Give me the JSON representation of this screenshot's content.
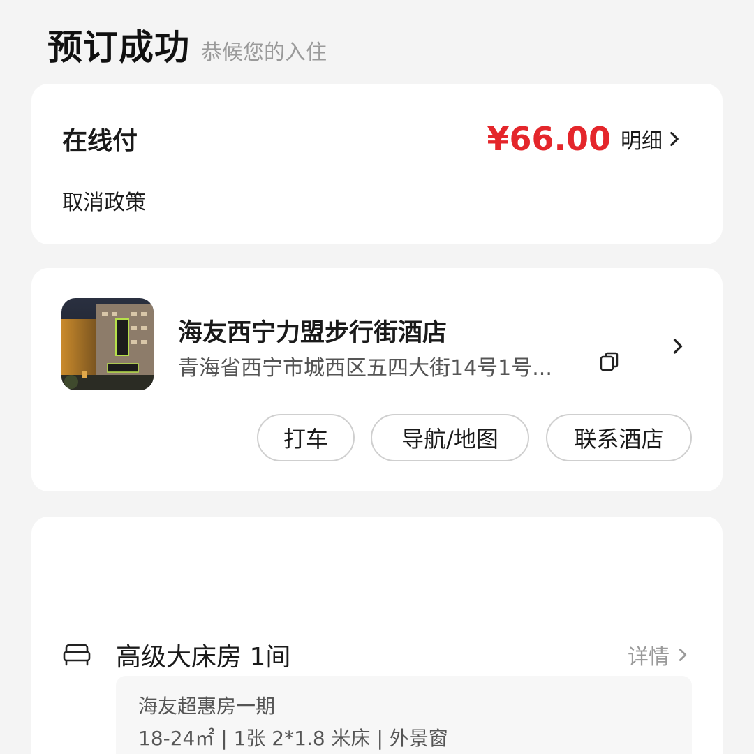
{
  "header": {
    "title": "预订成功",
    "subtitle": "恭候您的入住"
  },
  "payment": {
    "label": "在线付",
    "price": "¥66.00",
    "detail_label": "明细",
    "cancel_policy": "取消政策",
    "price_color": "#e4262b"
  },
  "hotel": {
    "name": "海友西宁力盟步行街酒店",
    "address": "青海省西宁市城西区五四大街14号1号...",
    "thumb_sign": "海友酒店",
    "actions": {
      "taxi": "打车",
      "navigation": "导航/地图",
      "contact": "联系酒店"
    }
  },
  "room": {
    "title": "高级大床房 1间",
    "detail_label": "详情",
    "plan": "海友超惠房一期",
    "specs": "18-24㎡ | 1张 2*1.8 米床 | 外景窗"
  },
  "icons": {
    "chevron": "chevron-right-icon",
    "copy": "copy-icon",
    "bed": "bed-icon"
  }
}
